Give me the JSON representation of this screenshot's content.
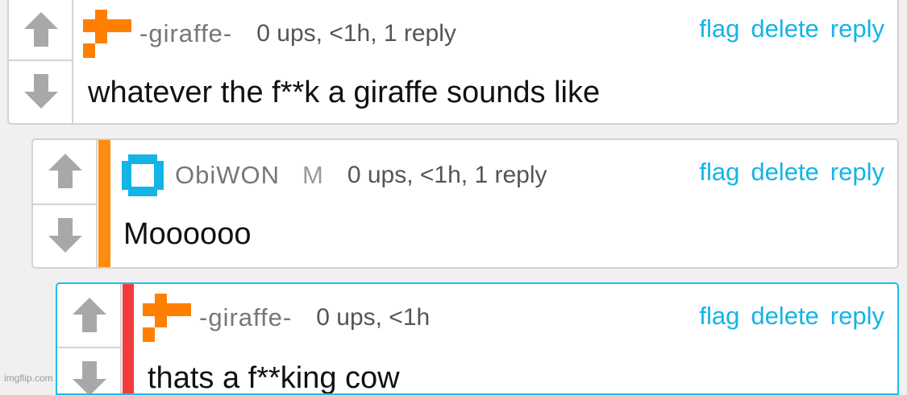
{
  "comments": [
    {
      "username": "-giraffe-",
      "badge": "",
      "meta": "0 ups, <1h, 1 reply",
      "text": "whatever the f**k a giraffe sounds like",
      "actions": {
        "flag": "flag",
        "delete": "delete",
        "reply": "reply"
      },
      "avatar_icon": "orange-pixel-avatar-icon",
      "avatar_color": "#ff8000"
    },
    {
      "username": "ObiWON",
      "badge": "M",
      "meta": "0 ups, <1h, 1 reply",
      "text": "Moooooo",
      "actions": {
        "flag": "flag",
        "delete": "delete",
        "reply": "reply"
      },
      "avatar_icon": "cyan-ring-avatar-icon",
      "avatar_color": "#14b4e6",
      "depth_bar_color": "#ff8c10"
    },
    {
      "username": "-giraffe-",
      "badge": "",
      "meta": "0 ups, <1h",
      "text": "thats a f**king cow",
      "actions": {
        "flag": "flag",
        "delete": "delete",
        "reply": "reply"
      },
      "avatar_icon": "orange-pixel-avatar-icon",
      "avatar_color": "#ff8000",
      "depth_bar_color": "#f03c3c",
      "highlight_border_color": "#1ec0e8"
    }
  ],
  "colors": {
    "link": "#14b4e6",
    "arrow": "#a8a8a8",
    "border": "#d3d3d3"
  },
  "watermark": "imgflip.com"
}
